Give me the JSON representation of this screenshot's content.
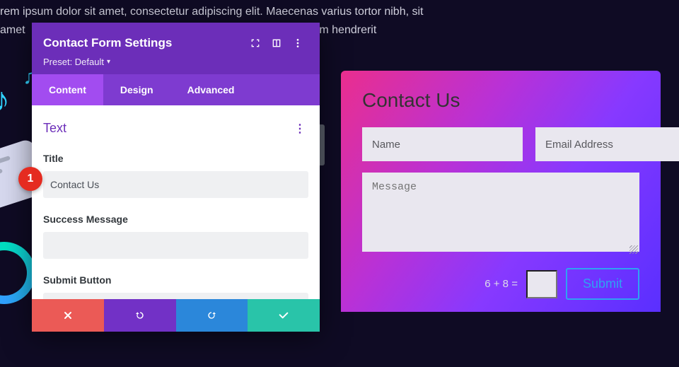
{
  "background_text": {
    "line1": "rem ipsum dolor sit amet, consectetur adipiscing elit. Maecenas varius tortor nibh, sit",
    "line2_a": "amet",
    "line2_b": "uam hendrerit"
  },
  "panel": {
    "title": "Contact Form Settings",
    "preset_label": "Preset: Default",
    "tabs": {
      "content": "Content",
      "design": "Design",
      "advanced": "Advanced"
    },
    "section": "Text",
    "fields": {
      "title_label": "Title",
      "title_value": "Contact Us",
      "success_label": "Success Message",
      "success_value": "",
      "submit_label": "Submit Button",
      "submit_value": ""
    }
  },
  "badge": {
    "number": "1"
  },
  "form": {
    "heading": "Contact Us",
    "name_ph": "Name",
    "email_ph": "Email Address",
    "message_ph": "Message",
    "captcha": "6 + 8 =",
    "submit": "Submit"
  }
}
